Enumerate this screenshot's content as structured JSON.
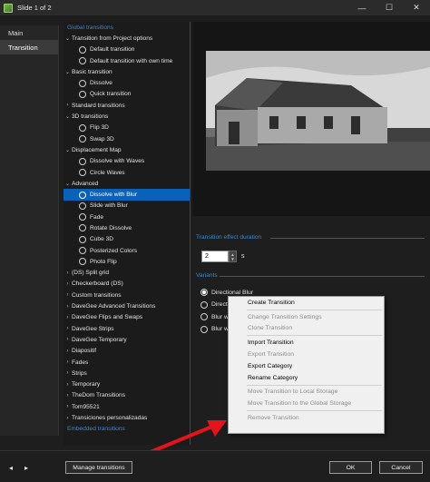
{
  "window": {
    "title": "Slide 1 of 2",
    "minimize": "—",
    "maximize": "☐",
    "close": "✕"
  },
  "leftnav": {
    "items": [
      {
        "label": "Main",
        "active": false
      },
      {
        "label": "Transition",
        "active": true
      }
    ]
  },
  "tree": {
    "rows": [
      {
        "label": "Global transitions",
        "kind": "header"
      },
      {
        "label": "Transition from Project options",
        "kind": "group"
      },
      {
        "label": "Default transition",
        "kind": "item"
      },
      {
        "label": "Default transition with own time",
        "kind": "item"
      },
      {
        "label": "Basic transition",
        "kind": "group"
      },
      {
        "label": "Dissolve",
        "kind": "item"
      },
      {
        "label": "Quick transition",
        "kind": "item"
      },
      {
        "label": "Standard transitions",
        "kind": "collapsed"
      },
      {
        "label": "3D transitions",
        "kind": "group"
      },
      {
        "label": "Flip 3D",
        "kind": "item"
      },
      {
        "label": "Swap 3D",
        "kind": "item"
      },
      {
        "label": "Displacement Map",
        "kind": "group"
      },
      {
        "label": "Dissolve with Waves",
        "kind": "item"
      },
      {
        "label": "Circle Waves",
        "kind": "item"
      },
      {
        "label": "Advanced",
        "kind": "group"
      },
      {
        "label": "Dissolve with Blur",
        "kind": "item",
        "selected": true
      },
      {
        "label": "Slide with Blur",
        "kind": "item"
      },
      {
        "label": "Fade",
        "kind": "item"
      },
      {
        "label": "Rotate Dissolve",
        "kind": "item"
      },
      {
        "label": "Cube 3D",
        "kind": "item"
      },
      {
        "label": "Posterized Colors",
        "kind": "item"
      },
      {
        "label": "Photo Flip",
        "kind": "item"
      },
      {
        "label": "(DS) Split grid",
        "kind": "collapsed"
      },
      {
        "label": "Checkerboard (DS)",
        "kind": "collapsed"
      },
      {
        "label": "Custom transitions",
        "kind": "collapsed"
      },
      {
        "label": "DaveGee Advanced Transitions",
        "kind": "collapsed"
      },
      {
        "label": "DaveGee Flips and Swaps",
        "kind": "collapsed"
      },
      {
        "label": "DaveGee Strips",
        "kind": "collapsed"
      },
      {
        "label": "DaveGee Temporary",
        "kind": "collapsed"
      },
      {
        "label": "Diapositif",
        "kind": "collapsed"
      },
      {
        "label": "Fades",
        "kind": "collapsed"
      },
      {
        "label": "Strips",
        "kind": "collapsed"
      },
      {
        "label": "Temporary",
        "kind": "collapsed"
      },
      {
        "label": "TheDom Transitions",
        "kind": "collapsed"
      },
      {
        "label": "Tom95521",
        "kind": "collapsed"
      },
      {
        "label": "Transiciones personalizadas",
        "kind": "collapsed"
      },
      {
        "label": "Embedded transitions",
        "kind": "header"
      }
    ]
  },
  "settings": {
    "duration_label": "Transition effect duration",
    "duration_value": "2",
    "duration_unit": "s",
    "variants_label": "Variants",
    "variants": [
      {
        "label": "Directional Blur",
        "checked": true
      },
      {
        "label": "Directi",
        "checked": false
      },
      {
        "label": "Blur w",
        "checked": false
      },
      {
        "label": "Blur w",
        "checked": false
      }
    ]
  },
  "context_menu": {
    "groups": [
      [
        {
          "label": "Create Transition",
          "enabled": true
        }
      ],
      [
        {
          "label": "Change Transition Settings",
          "enabled": false
        },
        {
          "label": "Clone Transition",
          "enabled": false
        }
      ],
      [
        {
          "label": "Import Transition",
          "enabled": true
        },
        {
          "label": "Export Transition",
          "enabled": false
        },
        {
          "label": "Export Category",
          "enabled": true
        },
        {
          "label": "Rename Category",
          "enabled": true
        }
      ],
      [
        {
          "label": "Move Transition to Local Storage",
          "enabled": false
        },
        {
          "label": "Move Transition to the Global Storage",
          "enabled": false
        }
      ],
      [
        {
          "label": "Remove Transition",
          "enabled": false
        }
      ]
    ]
  },
  "bottom": {
    "prev": "◂",
    "next": "▸",
    "manage_label": "Manage transitions",
    "ok_label": "OK",
    "cancel_label": "Cancel"
  },
  "colors": {
    "accent": "#0a62b8",
    "header_text": "#3d86c9",
    "arrow": "#e3141b"
  }
}
